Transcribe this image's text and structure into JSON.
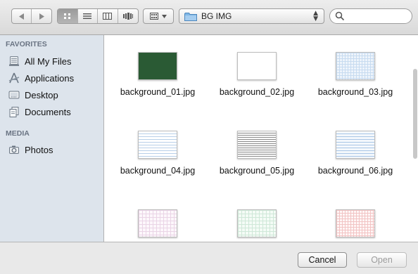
{
  "toolbar": {
    "back_icon": "back-triangle-icon",
    "forward_icon": "forward-triangle-icon",
    "view_icons": [
      "icon-view-icon",
      "list-view-icon",
      "column-view-icon",
      "coverflow-view-icon"
    ],
    "arrange_icon": "arrange-grid-icon",
    "location": "BG IMG",
    "search_value": ""
  },
  "sidebar": {
    "favorites_header": "FAVORITES",
    "favorites": [
      {
        "label": "All My Files",
        "icon": "all-files-icon"
      },
      {
        "label": "Applications",
        "icon": "applications-icon"
      },
      {
        "label": "Desktop",
        "icon": "desktop-icon"
      },
      {
        "label": "Documents",
        "icon": "documents-icon"
      }
    ],
    "media_header": "MEDIA",
    "media": [
      {
        "label": "Photos",
        "icon": "camera-icon"
      }
    ]
  },
  "files": [
    {
      "name": "background_01.jpg",
      "style": "green"
    },
    {
      "name": "background_02.jpg",
      "style": "blank"
    },
    {
      "name": "background_03.jpg",
      "style": "bluegrid"
    },
    {
      "name": "background_04.jpg",
      "style": "bluelines"
    },
    {
      "name": "background_05.jpg",
      "style": "graylines"
    },
    {
      "name": "background_06.jpg",
      "style": "bluelines"
    },
    {
      "name": "",
      "style": "pinkgrid"
    },
    {
      "name": "",
      "style": "greengrid"
    },
    {
      "name": "",
      "style": "redgrid"
    }
  ],
  "buttons": {
    "cancel": "Cancel",
    "open": "Open"
  },
  "colors": {
    "sidebar_bg": "#dde4ec",
    "green_thumb": "#2a5a34",
    "grid_blue": "#bcd4ee"
  }
}
